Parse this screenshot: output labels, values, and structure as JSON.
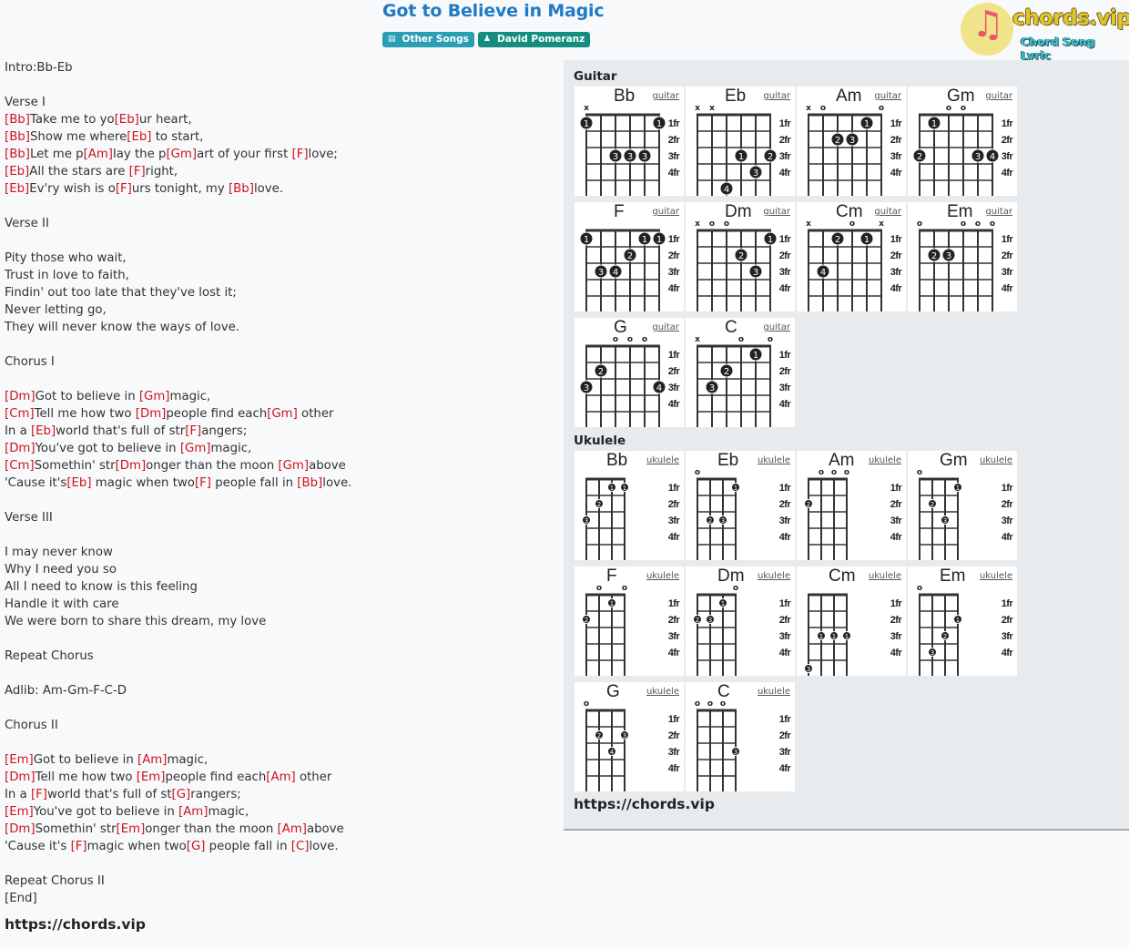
{
  "song": {
    "title": "Got to Believe in Magic",
    "category_label": "Other Songs",
    "category_icon": "book-icon",
    "artist_label": "David Pomeranz",
    "artist_icon": "user-icon"
  },
  "logo": {
    "brand": "chords.vip",
    "tagline": "Chord Song Lyric"
  },
  "lyrics": [
    [
      {
        "t": "Intro:Bb-Eb"
      }
    ],
    [],
    [
      {
        "t": "Verse I"
      }
    ],
    [
      {
        "c": "[Bb]"
      },
      {
        "t": "Take me to yo"
      },
      {
        "c": "[Eb]"
      },
      {
        "t": "ur heart,"
      }
    ],
    [
      {
        "c": "[Bb]"
      },
      {
        "t": "Show me where"
      },
      {
        "c": "[Eb]"
      },
      {
        "t": " to start,"
      }
    ],
    [
      {
        "c": "[Bb]"
      },
      {
        "t": "Let me p"
      },
      {
        "c": "[Am]"
      },
      {
        "t": "lay the p"
      },
      {
        "c": "[Gm]"
      },
      {
        "t": "art of your first "
      },
      {
        "c": "[F]"
      },
      {
        "t": "love;"
      }
    ],
    [
      {
        "c": "[Eb]"
      },
      {
        "t": "All the stars are "
      },
      {
        "c": "[F]"
      },
      {
        "t": "right,"
      }
    ],
    [
      {
        "c": "[Eb]"
      },
      {
        "t": "Ev'ry wish is o"
      },
      {
        "c": "[F]"
      },
      {
        "t": "urs tonight, my "
      },
      {
        "c": "[Bb]"
      },
      {
        "t": "love."
      }
    ],
    [],
    [
      {
        "t": "Verse II"
      }
    ],
    [],
    [
      {
        "t": "Pity those who wait,"
      }
    ],
    [
      {
        "t": "Trust in love to faith,"
      }
    ],
    [
      {
        "t": "Findin' out too late that they've lost it;"
      }
    ],
    [
      {
        "t": "Never letting go,"
      }
    ],
    [
      {
        "t": "They will never know the ways of love."
      }
    ],
    [],
    [
      {
        "t": "Chorus I"
      }
    ],
    [],
    [
      {
        "c": "[Dm]"
      },
      {
        "t": "Got to believe in "
      },
      {
        "c": "[Gm]"
      },
      {
        "t": "magic,"
      }
    ],
    [
      {
        "c": "[Cm]"
      },
      {
        "t": "Tell me how two "
      },
      {
        "c": "[Dm]"
      },
      {
        "t": "people find each"
      },
      {
        "c": "[Gm]"
      },
      {
        "t": " other"
      }
    ],
    [
      {
        "t": "In a "
      },
      {
        "c": "[Eb]"
      },
      {
        "t": "world that's full of str"
      },
      {
        "c": "[F]"
      },
      {
        "t": "angers;"
      }
    ],
    [
      {
        "c": "[Dm]"
      },
      {
        "t": "You've got to believe in "
      },
      {
        "c": "[Gm]"
      },
      {
        "t": "magic,"
      }
    ],
    [
      {
        "c": "[Cm]"
      },
      {
        "t": "Somethin' str"
      },
      {
        "c": "[Dm]"
      },
      {
        "t": "onger than the moon "
      },
      {
        "c": "[Gm]"
      },
      {
        "t": "above"
      }
    ],
    [
      {
        "t": "'Cause it's"
      },
      {
        "c": "[Eb]"
      },
      {
        "t": " magic when two"
      },
      {
        "c": "[F]"
      },
      {
        "t": " people fall in "
      },
      {
        "c": "[Bb]"
      },
      {
        "t": "love."
      }
    ],
    [],
    [
      {
        "t": "Verse III"
      }
    ],
    [],
    [
      {
        "t": "I may never know"
      }
    ],
    [
      {
        "t": "Why I need you so"
      }
    ],
    [
      {
        "t": "All I need to know is this feeling"
      }
    ],
    [
      {
        "t": "Handle it with care"
      }
    ],
    [
      {
        "t": "We were born to share this dream, my love"
      }
    ],
    [],
    [
      {
        "t": "Repeat Chorus"
      }
    ],
    [],
    [
      {
        "t": "Adlib: Am-Gm-F-C-D"
      }
    ],
    [],
    [
      {
        "t": "Chorus II"
      }
    ],
    [],
    [
      {
        "c": "[Em]"
      },
      {
        "t": "Got to believe in "
      },
      {
        "c": "[Am]"
      },
      {
        "t": "magic,"
      }
    ],
    [
      {
        "c": "[Dm]"
      },
      {
        "t": "Tell me how two "
      },
      {
        "c": "[Em]"
      },
      {
        "t": "people find each"
      },
      {
        "c": "[Am]"
      },
      {
        "t": " other"
      }
    ],
    [
      {
        "t": "In a "
      },
      {
        "c": "[F]"
      },
      {
        "t": "world that's full of st"
      },
      {
        "c": "[G]"
      },
      {
        "t": "rangers;"
      }
    ],
    [
      {
        "c": "[Em]"
      },
      {
        "t": "You've got to believe in "
      },
      {
        "c": "[Am]"
      },
      {
        "t": "magic,"
      }
    ],
    [
      {
        "c": "[Dm]"
      },
      {
        "t": "Somethin' str"
      },
      {
        "c": "[Em]"
      },
      {
        "t": "onger than the moon "
      },
      {
        "c": "[Am]"
      },
      {
        "t": "above"
      }
    ],
    [
      {
        "t": "'Cause it's "
      },
      {
        "c": "[F]"
      },
      {
        "t": "magic when two"
      },
      {
        "c": "[G]"
      },
      {
        "t": " people fall in "
      },
      {
        "c": "[C]"
      },
      {
        "t": "love."
      }
    ],
    [],
    [
      {
        "t": "Repeat Chorus II"
      }
    ],
    [
      {
        "t": "[End]"
      }
    ]
  ],
  "lyrics_footer_url": "https://chords.vip",
  "panel": {
    "guitar_heading": "Guitar",
    "ukulele_heading": "Ukulele",
    "footer_url": "https://chords.vip",
    "fret_labels": [
      "1fr",
      "2fr",
      "3fr",
      "4fr"
    ],
    "guitar_link": "guitar",
    "ukulele_link": "ukulele",
    "guitar_chords": [
      {
        "name": "Bb",
        "strings": [
          "x",
          null,
          null,
          null,
          null,
          null
        ],
        "dots": [
          [
            1,
            1,
            "1"
          ],
          [
            6,
            1,
            "1"
          ],
          [
            3,
            3,
            "3"
          ],
          [
            4,
            3,
            "3"
          ],
          [
            5,
            3,
            "3"
          ]
        ]
      },
      {
        "name": "Eb",
        "strings": [
          "x",
          "x",
          null,
          null,
          null,
          null
        ],
        "dots": [
          [
            4,
            3,
            "1"
          ],
          [
            6,
            3,
            "2"
          ],
          [
            5,
            4,
            "3"
          ],
          [
            3,
            5,
            "4"
          ]
        ]
      },
      {
        "name": "Am",
        "strings": [
          "x",
          "o",
          null,
          null,
          null,
          "o"
        ],
        "dots": [
          [
            5,
            1,
            "1"
          ],
          [
            3,
            2,
            "2"
          ],
          [
            4,
            2,
            "3"
          ]
        ]
      },
      {
        "name": "Gm",
        "strings": [
          null,
          null,
          "o",
          "o",
          null,
          null
        ],
        "dots": [
          [
            2,
            1,
            "1"
          ],
          [
            1,
            3,
            "2"
          ],
          [
            5,
            3,
            "3"
          ],
          [
            6,
            3,
            "4"
          ]
        ]
      },
      {
        "name": "F",
        "strings": [
          null,
          null,
          null,
          null,
          null,
          null
        ],
        "dots": [
          [
            1,
            1,
            "1"
          ],
          [
            5,
            1,
            "1"
          ],
          [
            6,
            1,
            "1"
          ],
          [
            4,
            2,
            "2"
          ],
          [
            2,
            3,
            "3"
          ],
          [
            3,
            3,
            "4"
          ]
        ]
      },
      {
        "name": "Dm",
        "strings": [
          "x",
          "o",
          "o",
          null,
          null,
          null
        ],
        "dots": [
          [
            6,
            1,
            "1"
          ],
          [
            4,
            2,
            "2"
          ],
          [
            5,
            3,
            "3"
          ]
        ]
      },
      {
        "name": "Cm",
        "strings": [
          "x",
          null,
          null,
          "o",
          null,
          "x"
        ],
        "dots": [
          [
            3,
            1,
            "2"
          ],
          [
            5,
            1,
            "1"
          ],
          [
            2,
            3,
            "4"
          ]
        ]
      },
      {
        "name": "Em",
        "strings": [
          "o",
          null,
          null,
          "o",
          "o",
          "o"
        ],
        "dots": [
          [
            2,
            2,
            "2"
          ],
          [
            3,
            2,
            "3"
          ]
        ]
      },
      {
        "name": "G",
        "strings": [
          null,
          null,
          "o",
          "o",
          "o",
          null
        ],
        "dots": [
          [
            2,
            2,
            "2"
          ],
          [
            1,
            3,
            "3"
          ],
          [
            6,
            3,
            "4"
          ]
        ]
      },
      {
        "name": "C",
        "strings": [
          "x",
          null,
          null,
          "o",
          null,
          "o"
        ],
        "dots": [
          [
            5,
            1,
            "1"
          ],
          [
            3,
            2,
            "2"
          ],
          [
            2,
            3,
            "3"
          ]
        ]
      }
    ],
    "ukulele_chords": [
      {
        "name": "Bb",
        "strings": [
          null,
          null,
          null,
          null
        ],
        "dots": [
          [
            3,
            1,
            "1"
          ],
          [
            4,
            1,
            "1"
          ],
          [
            2,
            2,
            "2"
          ],
          [
            1,
            3,
            "3"
          ]
        ]
      },
      {
        "name": "Eb",
        "strings": [
          "o",
          null,
          null,
          null
        ],
        "dots": [
          [
            4,
            1,
            "1"
          ],
          [
            2,
            3,
            "2"
          ],
          [
            3,
            3,
            "3"
          ]
        ]
      },
      {
        "name": "Am",
        "strings": [
          null,
          "o",
          "o",
          "o"
        ],
        "dots": [
          [
            1,
            2,
            "2"
          ]
        ]
      },
      {
        "name": "Gm",
        "strings": [
          "o",
          null,
          null,
          null
        ],
        "dots": [
          [
            4,
            1,
            "1"
          ],
          [
            2,
            2,
            "2"
          ],
          [
            3,
            3,
            "3"
          ]
        ]
      },
      {
        "name": "F",
        "strings": [
          null,
          "o",
          null,
          "o"
        ],
        "dots": [
          [
            3,
            1,
            "1"
          ],
          [
            1,
            2,
            "2"
          ]
        ]
      },
      {
        "name": "Dm",
        "strings": [
          null,
          null,
          null,
          "o"
        ],
        "dots": [
          [
            3,
            1,
            "1"
          ],
          [
            1,
            2,
            "2"
          ],
          [
            2,
            2,
            "3"
          ]
        ]
      },
      {
        "name": "Cm",
        "strings": [
          null,
          null,
          null,
          null
        ],
        "dots": [
          [
            2,
            3,
            "1"
          ],
          [
            3,
            3,
            "1"
          ],
          [
            4,
            3,
            "1"
          ],
          [
            1,
            5,
            "3"
          ]
        ]
      },
      {
        "name": "Em",
        "strings": [
          "o",
          null,
          null,
          null
        ],
        "dots": [
          [
            4,
            2,
            "1"
          ],
          [
            3,
            3,
            "2"
          ],
          [
            2,
            4,
            "3"
          ]
        ]
      },
      {
        "name": "G",
        "strings": [
          "o",
          null,
          null,
          null
        ],
        "dots": [
          [
            2,
            2,
            "2"
          ],
          [
            4,
            2,
            "3"
          ],
          [
            3,
            3,
            "4"
          ]
        ]
      },
      {
        "name": "C",
        "strings": [
          "o",
          "o",
          "o",
          null
        ],
        "dots": [
          [
            4,
            3,
            "3"
          ]
        ]
      }
    ]
  }
}
